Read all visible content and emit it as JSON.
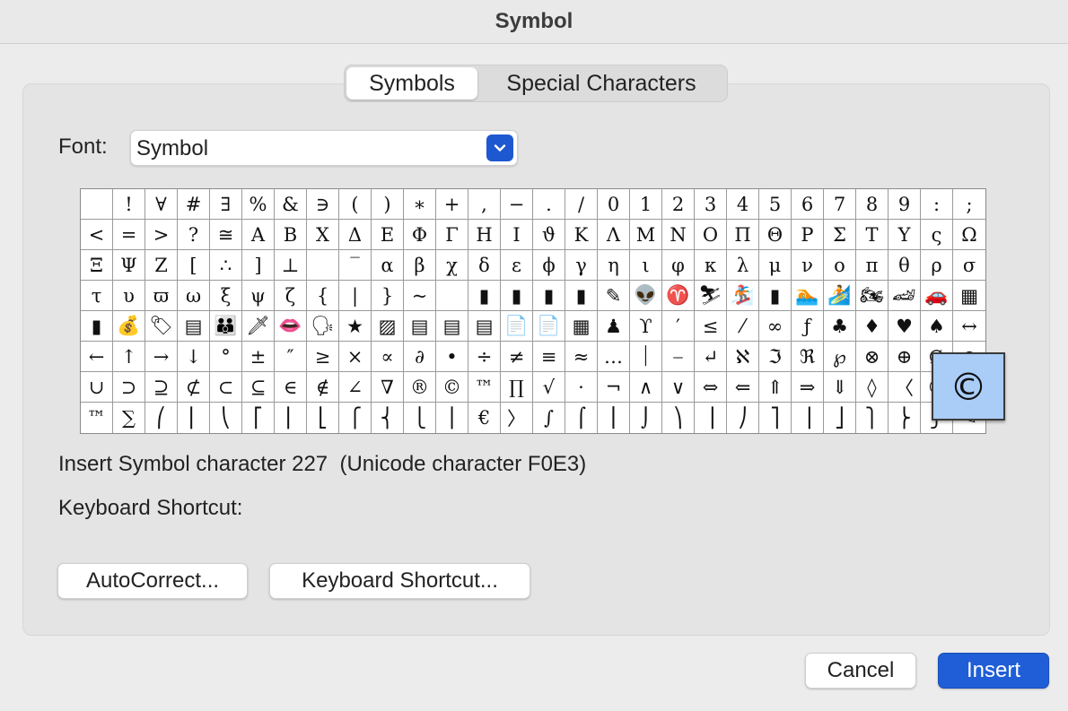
{
  "window": {
    "title": "Symbol"
  },
  "tabs": [
    {
      "label": "Symbols",
      "active": true
    },
    {
      "label": "Special Characters",
      "active": false
    }
  ],
  "font": {
    "label": "Font:",
    "value": "Symbol"
  },
  "grid": {
    "columns": 28,
    "rows": [
      [
        " ",
        "!",
        "∀",
        "#",
        "∃",
        "%",
        "&",
        "∋",
        "(",
        ")",
        "∗",
        "+",
        ",",
        "−",
        ".",
        "/",
        "0",
        "1",
        "2",
        "3",
        "4",
        "5",
        "6",
        "7",
        "8",
        "9",
        ":",
        ";"
      ],
      [
        "<",
        "=",
        ">",
        "?",
        "≅",
        "Α",
        "Β",
        "Χ",
        "Δ",
        "Ε",
        "Φ",
        "Γ",
        "Η",
        "Ι",
        "ϑ",
        "Κ",
        "Λ",
        "Μ",
        "Ν",
        "Ο",
        "Π",
        "Θ",
        "Ρ",
        "Σ",
        "Τ",
        "Υ",
        "ς",
        "Ω"
      ],
      [
        "Ξ",
        "Ψ",
        "Ζ",
        "[",
        "∴",
        "]",
        "⊥",
        "",
        "‾",
        "α",
        "β",
        "χ",
        "δ",
        "ε",
        "ϕ",
        "γ",
        "η",
        "ι",
        "φ",
        "κ",
        "λ",
        "μ",
        "ν",
        "ο",
        "π",
        "θ",
        "ρ",
        "σ"
      ],
      [
        "τ",
        "υ",
        "ϖ",
        "ω",
        "ξ",
        "ψ",
        "ζ",
        "{",
        "|",
        "}",
        "~",
        "",
        "▮",
        "▮",
        "▮",
        "▮",
        "✎",
        "👽",
        "♈",
        "⛷",
        "🏂",
        "▮",
        "🏊",
        "🏄",
        "🏍",
        "🏎",
        "🚗",
        "▦"
      ],
      [
        "▮",
        "💰",
        "🏷",
        "▤",
        "👪",
        "🗡",
        "👄",
        "🗣",
        "★",
        "▨",
        "▤",
        "▤",
        "▤",
        "📄",
        "📄",
        "▦",
        "♟",
        "ϒ",
        "′",
        "≤",
        "⁄",
        "∞",
        "ƒ",
        "♣",
        "♦",
        "♥",
        "♠",
        "↔"
      ],
      [
        "←",
        "↑",
        "→",
        "↓",
        "°",
        "±",
        "″",
        "≥",
        "×",
        "∝",
        "∂",
        "•",
        "÷",
        "≠",
        "≡",
        "≈",
        "…",
        "⏐",
        "⎯",
        "↵",
        "ℵ",
        "ℑ",
        "ℜ",
        "℘",
        "⊗",
        "⊕",
        "∅",
        "∩"
      ],
      [
        "∪",
        "⊃",
        "⊇",
        "⊄",
        "⊂",
        "⊆",
        "∈",
        "∉",
        "∠",
        "∇",
        "®",
        "©",
        "™",
        "∏",
        "√",
        "⋅",
        "¬",
        "∧",
        "∨",
        "⇔",
        "⇐",
        "⇑",
        "⇒",
        "⇓",
        "◊",
        "〈",
        "®",
        "©"
      ],
      [
        "™",
        "∑",
        "⎛",
        "⎜",
        "⎝",
        "⎡",
        "⎢",
        "⎣",
        "⎧",
        "⎨",
        "⎩",
        "⎪",
        "€",
        "〉",
        "∫",
        "⌠",
        "⎮",
        "⌡",
        "⎞",
        "⎟",
        "⎠",
        "⎤",
        "⎥",
        "⎦",
        "⎫",
        "⎬",
        "⎭",
        "✎"
      ]
    ]
  },
  "preview": {
    "glyph": "©"
  },
  "info_text": "Insert Symbol character 227  (Unicode character F0E3)",
  "shortcut_label": "Keyboard Shortcut:",
  "buttons": {
    "autocorrect": "AutoCorrect...",
    "keyboard_shortcut": "Keyboard Shortcut...",
    "cancel": "Cancel",
    "insert": "Insert"
  },
  "colors": {
    "accent": "#1f5ed6",
    "selection": "#a9cdf7"
  },
  "icons": {
    "dropdown": "chevron-down-icon"
  }
}
